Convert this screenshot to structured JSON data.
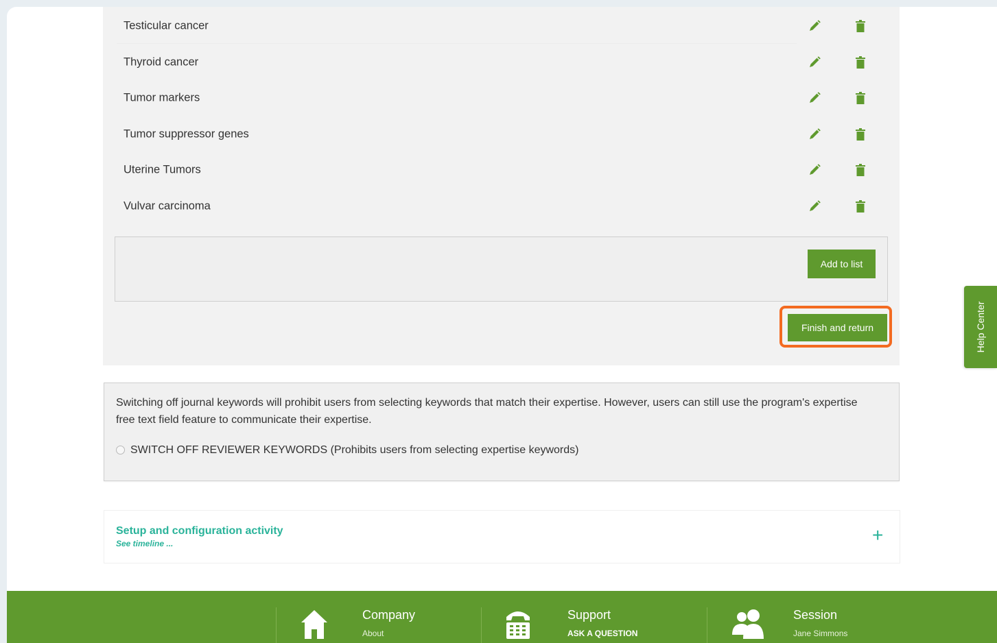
{
  "keywords": [
    {
      "label": "Testicular cancer"
    },
    {
      "label": "Thyroid cancer"
    },
    {
      "label": "Tumor markers"
    },
    {
      "label": "Tumor suppressor genes"
    },
    {
      "label": "Uterine Tumors"
    },
    {
      "label": "Vulvar carcinoma"
    }
  ],
  "add_box": {
    "button_label": "Add to list"
  },
  "finish_button": {
    "label": "Finish and return"
  },
  "switch_section": {
    "description": "Switching off journal keywords will prohibit users from selecting keywords that match their expertise. However, users can still use the program's expertise free text field feature to communicate their expertise.",
    "radio_label": "SWITCH OFF REVIEWER KEYWORDS (Prohibits users from selecting expertise keywords)",
    "radio_selected": false
  },
  "activity": {
    "title": "Setup and configuration activity",
    "subtitle": "See timeline ...",
    "expand_glyph": "+"
  },
  "help_tab": {
    "label": "Help Center"
  },
  "footer": {
    "company": {
      "title": "Company",
      "link": "About",
      "icon": "home-icon"
    },
    "support": {
      "title": "Support",
      "link": "ASK A QUESTION",
      "icon": "telephone-icon"
    },
    "session": {
      "title": "Session",
      "user": "Jane Simmons",
      "icon": "users-icon"
    }
  },
  "colors": {
    "accent_green": "#5f9a2e",
    "teal_link": "#2ab39a",
    "highlight_orange": "#f36b21"
  }
}
